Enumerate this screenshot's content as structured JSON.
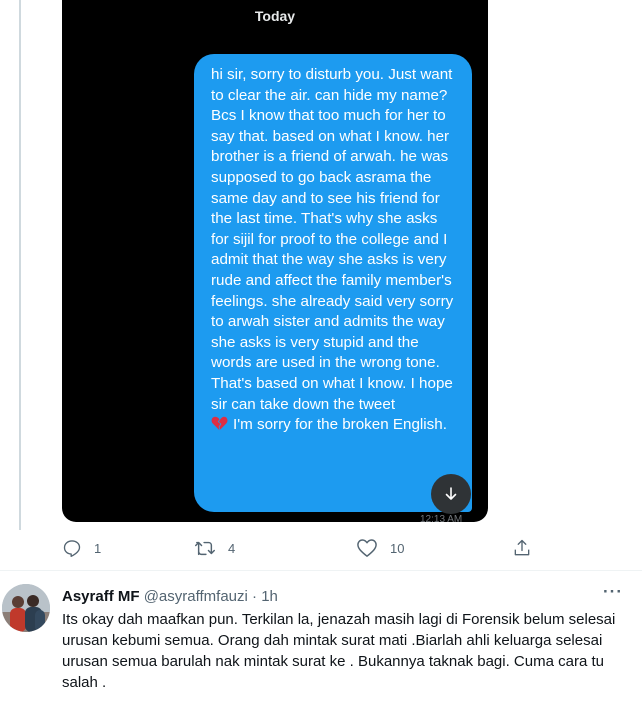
{
  "conversation": {
    "date_label": "Today",
    "message_text": "hi sir, sorry to disturb you. Just want to clear the air. can hide my name? Bcs I know that too much for her to say that. based on what I know. her brother is a friend of arwah. he was supposed to go back asrama the same day and to see his friend for the last time. That's why she asks for sijil for proof to the college and I admit that the way she asks is very rude and affect the family member's feelings. she already said very sorry to arwah sister and admits the way she asks is very stupid and the words are used in the wrong tone. That's based on what I know. I hope sir can take down the tweet",
    "message_tail": "I'm sorry for the broken English.",
    "heart_icon": "broken-heart-icon",
    "timestamp": "12:13 AM"
  },
  "tweet_actions": {
    "reply_count": "1",
    "retweet_count": "4",
    "like_count": "10"
  },
  "reply": {
    "display_name": "Asyraff MF",
    "handle": "@asyraffmfauzi",
    "separator": " · ",
    "time": "1h",
    "text": "Its okay dah maafkan pun. Terkilan la, jenazah masih lagi di Forensik belum selesai urusan kebumi semua. Orang dah mintak surat mati .Biarlah ahli keluarga selesai urusan semua barulah nak mintak surat ke . Bukannya taknak bagi. Cuma cara tu salah .",
    "more_label": "···"
  },
  "colors": {
    "bubble": "#1d9bf0",
    "dm_background": "#000000",
    "secondary_text": "#536471"
  }
}
